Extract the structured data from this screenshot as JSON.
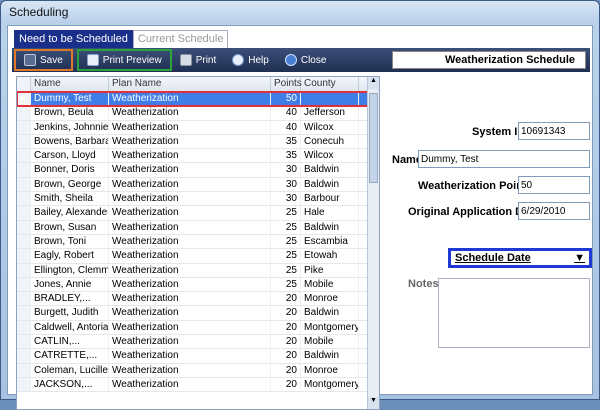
{
  "window": {
    "title": "Scheduling"
  },
  "tabs": [
    {
      "label": "Need to be Scheduled"
    },
    {
      "label": "Current Schedule"
    }
  ],
  "toolbar": {
    "save": "Save",
    "print_preview": "Print Preview",
    "print": "Print",
    "help": "Help",
    "close": "Close",
    "schedule_title": "Weatherization Schedule"
  },
  "grid": {
    "columns": [
      "Name",
      "Plan Name",
      "Points",
      "County"
    ],
    "rows": [
      {
        "name": "Dummy, Test",
        "plan": "Weatherization",
        "points": "50",
        "county": ""
      },
      {
        "name": "Brown, Beula",
        "plan": "Weatherization",
        "points": "40",
        "county": "Jefferson"
      },
      {
        "name": "Jenkins, Johnnie",
        "plan": "Weatherization",
        "points": "40",
        "county": "Wilcox"
      },
      {
        "name": "Bowens, Barbara",
        "plan": "Weatherization",
        "points": "35",
        "county": "Conecuh"
      },
      {
        "name": "Carson, Lloyd",
        "plan": "Weatherization",
        "points": "35",
        "county": "Wilcox"
      },
      {
        "name": "Bonner, Doris",
        "plan": "Weatherization",
        "points": "30",
        "county": "Baldwin"
      },
      {
        "name": "Brown, George",
        "plan": "Weatherization",
        "points": "30",
        "county": "Baldwin"
      },
      {
        "name": "Smith, Sheila",
        "plan": "Weatherization",
        "points": "30",
        "county": "Barbour"
      },
      {
        "name": "Bailey, Alexander",
        "plan": "Weatherization",
        "points": "25",
        "county": "Hale"
      },
      {
        "name": "Brown, Susan",
        "plan": "Weatherization",
        "points": "25",
        "county": "Baldwin"
      },
      {
        "name": "Brown, Toni",
        "plan": "Weatherization",
        "points": "25",
        "county": "Escambia"
      },
      {
        "name": "Eagly, Robert",
        "plan": "Weatherization",
        "points": "25",
        "county": "Etowah"
      },
      {
        "name": "Ellington, Clemmie",
        "plan": "Weatherization",
        "points": "25",
        "county": "Pike"
      },
      {
        "name": "Jones, Annie",
        "plan": "Weatherization",
        "points": "25",
        "county": "Mobile"
      },
      {
        "name": "BRADLEY,...",
        "plan": "Weatherization",
        "points": "20",
        "county": "Monroe"
      },
      {
        "name": "Burgett, Judith",
        "plan": "Weatherization",
        "points": "20",
        "county": "Baldwin"
      },
      {
        "name": "Caldwell, Antoria",
        "plan": "Weatherization",
        "points": "20",
        "county": "Montgomery"
      },
      {
        "name": "CATLIN,...",
        "plan": "Weatherization",
        "points": "20",
        "county": "Mobile"
      },
      {
        "name": "CATRETTE,...",
        "plan": "Weatherization",
        "points": "20",
        "county": "Baldwin"
      },
      {
        "name": "Coleman, Lucille",
        "plan": "Weatherization",
        "points": "20",
        "county": "Monroe"
      },
      {
        "name": "JACKSON,...",
        "plan": "Weatherization",
        "points": "20",
        "county": "Montgomery"
      }
    ]
  },
  "form": {
    "system_id_label": "System ID",
    "system_id": "10691343",
    "name_label": "Name",
    "name": "Dummy, Test",
    "points_label": "Weatherization Points",
    "points": "50",
    "app_date_label": "Original Application Date",
    "app_date": "6/29/2010",
    "schedule_date_label": "Schedule Date",
    "notes_label": "Notes",
    "notes": ""
  }
}
